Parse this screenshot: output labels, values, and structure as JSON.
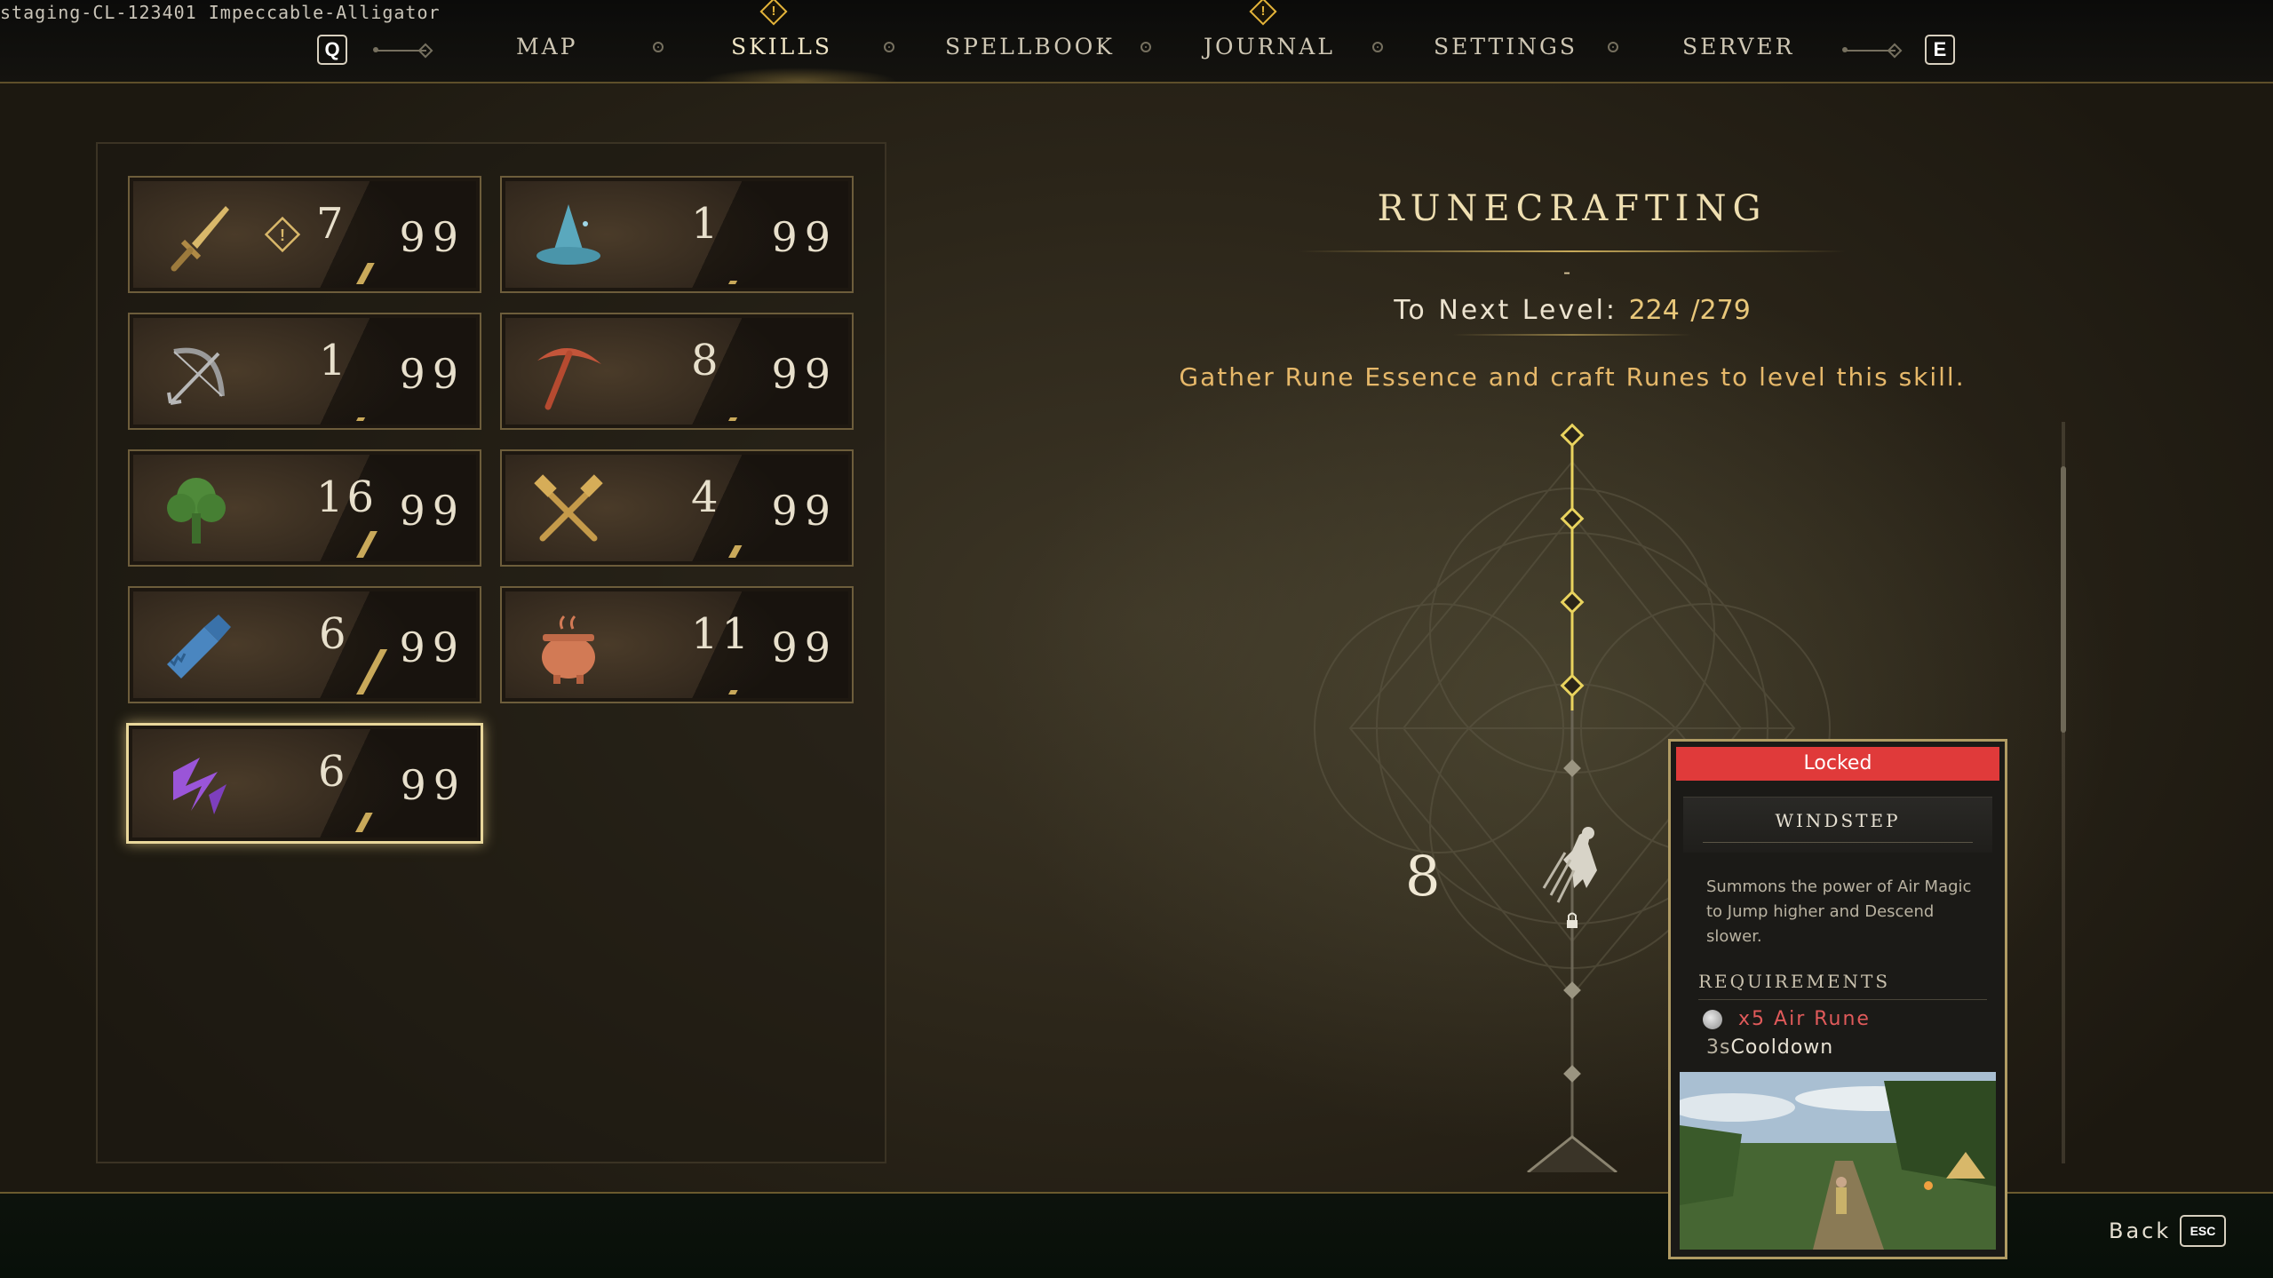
{
  "build_label": "staging-CL-123401 Impeccable-Alligator",
  "nav": {
    "left_key": "Q",
    "right_key": "E",
    "tabs": [
      {
        "label": "MAP",
        "active": false,
        "alert": false
      },
      {
        "label": "SKILLS",
        "active": true,
        "alert": true
      },
      {
        "label": "SPELLBOOK",
        "active": false,
        "alert": false
      },
      {
        "label": "JOURNAL",
        "active": false,
        "alert": true
      },
      {
        "label": "SETTINGS",
        "active": false,
        "alert": false
      },
      {
        "label": "SERVER",
        "active": false,
        "alert": false
      }
    ],
    "alert_glyph": "!"
  },
  "skills": [
    {
      "icon": "sword-icon",
      "level": "7",
      "max": "99",
      "alert": true,
      "active": false,
      "progress": 0.45
    },
    {
      "icon": "wizard-hat-icon",
      "level": "1",
      "max": "99",
      "alert": false,
      "active": false,
      "progress": 0.0
    },
    {
      "icon": "bow-icon",
      "level": "1",
      "max": "99",
      "alert": false,
      "active": false,
      "progress": 0.0
    },
    {
      "icon": "pickaxe-icon",
      "level": "8",
      "max": "99",
      "alert": false,
      "active": false,
      "progress": 0.05
    },
    {
      "icon": "tree-icon",
      "level": "16",
      "max": "99",
      "alert": false,
      "active": false,
      "progress": 0.55
    },
    {
      "icon": "hammers-icon",
      "level": "4",
      "max": "99",
      "alert": false,
      "active": false,
      "progress": 0.25
    },
    {
      "icon": "saw-icon",
      "level": "6",
      "max": "99",
      "alert": false,
      "active": false,
      "progress": 0.95
    },
    {
      "icon": "cauldron-icon",
      "level": "11",
      "max": "99",
      "alert": false,
      "active": false,
      "progress": 0.1
    },
    {
      "icon": "rune-icon",
      "level": "6",
      "max": "99",
      "alert": false,
      "active": true,
      "progress": 0.4
    }
  ],
  "detail": {
    "title": "RUNECRAFTING",
    "dash": "-",
    "next_level_label": "To Next Level:",
    "next_level_current": "224",
    "next_level_sep": "/",
    "next_level_total": "279",
    "description": "Gather Rune Essence and craft Runes to level this skill.",
    "node_level": "8",
    "unlocked_nodes": 4
  },
  "tooltip": {
    "status": "Locked",
    "name": "WINDSTEP",
    "description": "Summons the power of Air Magic to Jump higher and Descend slower.",
    "requirements_title": "REQUIREMENTS",
    "rune_qty": "x5",
    "rune_name": "Air Rune",
    "cooldown_value": "3s",
    "cooldown_label": "Cooldown"
  },
  "footer": {
    "back_label": "Back",
    "back_key": "ESC"
  },
  "colors": {
    "accent_gold": "#e8c77a",
    "locked_red": "#e03a3a",
    "requirement_red": "#e05a5a",
    "active_border": "#e9d79b"
  }
}
